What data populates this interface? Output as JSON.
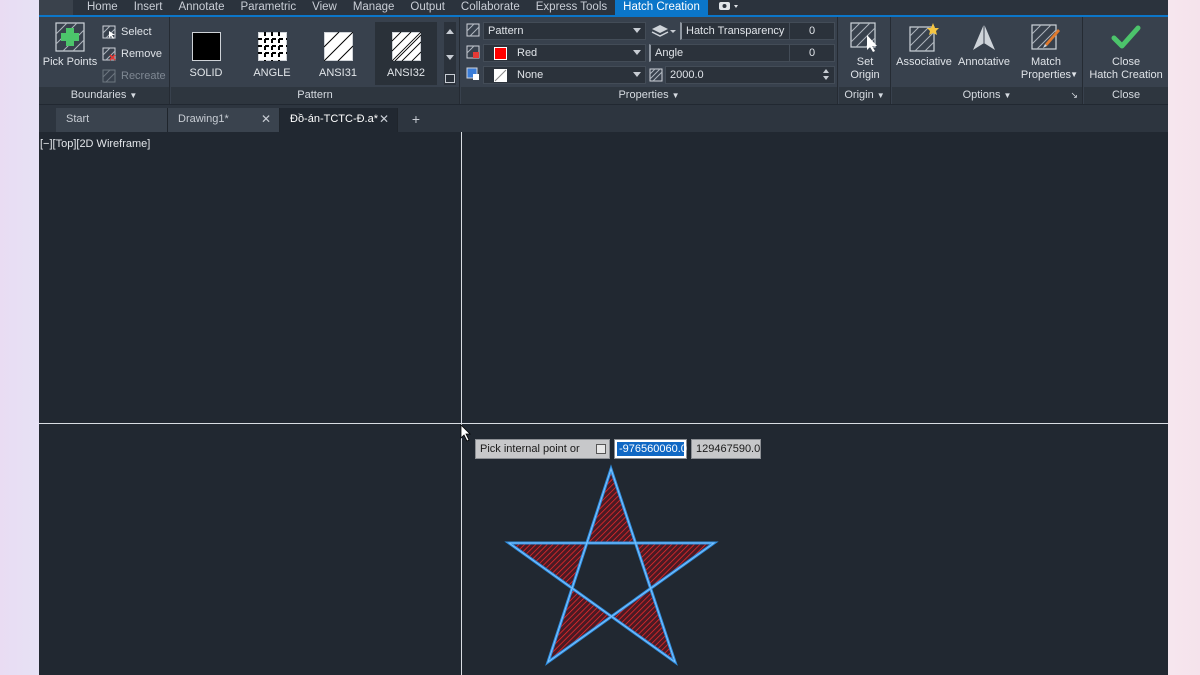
{
  "menubar": {
    "tabs": [
      "Home",
      "Insert",
      "Annotate",
      "Parametric",
      "View",
      "Manage",
      "Output",
      "Collaborate",
      "Express Tools",
      "Hatch Creation"
    ],
    "active_tab": "Hatch Creation"
  },
  "ribbon": {
    "boundaries": {
      "pick_points": "Pick Points",
      "select": "Select",
      "remove": "Remove",
      "recreate": "Recreate",
      "title": "Boundaries"
    },
    "pattern": {
      "swatches": [
        "SOLID",
        "ANGLE",
        "ANSI31",
        "ANSI32"
      ],
      "selected": "ANSI32",
      "title": "Pattern"
    },
    "properties": {
      "type": "Pattern",
      "color": "Red",
      "color_hex": "#ff0000",
      "background": "None",
      "transparency_label": "Hatch Transparency",
      "transparency_value": "0",
      "angle_label": "Angle",
      "angle_value": "0",
      "scale_value": "2000.0",
      "title": "Properties"
    },
    "origin": {
      "set_origin_line1": "Set",
      "set_origin_line2": "Origin",
      "title": "Origin"
    },
    "options": {
      "associative": "Associative",
      "annotative": "Annotative",
      "match_line1": "Match",
      "match_line2": "Properties",
      "title": "Options"
    },
    "close": {
      "line1": "Close",
      "line2": "Hatch Creation",
      "title": "Close"
    }
  },
  "file_tabs": {
    "start": "Start",
    "drawing1": "Drawing1*",
    "active_doc": "Đồ-án-TCTC-Đ.a*"
  },
  "viewport": {
    "label": "[−][Top][2D Wireframe]",
    "prompt": "Pick internal point or",
    "coord_x": "-976560060.0",
    "coord_y": "129467590.0",
    "star_outline_color": "#2e8ee0",
    "hatch_color": "#ff0000"
  }
}
